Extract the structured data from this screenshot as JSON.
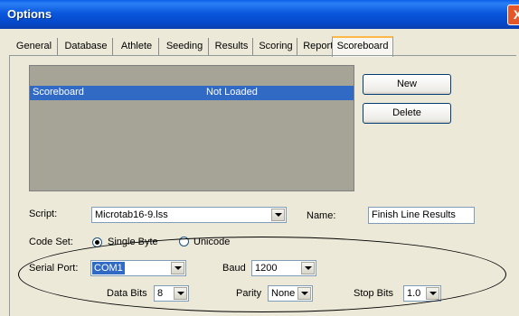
{
  "window": {
    "title": "Options",
    "close_glyph": "X"
  },
  "tabs": [
    {
      "label": "General"
    },
    {
      "label": "Database"
    },
    {
      "label": "Athlete"
    },
    {
      "label": "Seeding"
    },
    {
      "label": "Results"
    },
    {
      "label": "Scoring"
    },
    {
      "label": "Reports"
    },
    {
      "label": "Scoreboard",
      "active": true
    }
  ],
  "list": {
    "rows": [
      {
        "name": "Scoreboard",
        "status": "Not Loaded"
      }
    ]
  },
  "buttons": {
    "new_label": "New",
    "delete_label": "Delete"
  },
  "form": {
    "script_label": "Script:",
    "script_value": "Microtab16-9.lss",
    "name_label": "Name:",
    "name_value": "Finish Line Results",
    "code_set_label": "Code Set:",
    "single_byte_label": "Single Byte",
    "unicode_label": "Unicode",
    "code_set_selected": "Single Byte",
    "serial_port_label": "Serial Port:",
    "serial_port_value": "COM1",
    "baud_label": "Baud",
    "baud_value": "1200",
    "data_bits_label": "Data Bits",
    "data_bits_value": "8",
    "parity_label": "Parity",
    "parity_value": "None",
    "stop_bits_label": "Stop Bits",
    "stop_bits_value": "1.0"
  },
  "colors": {
    "titlebar": "#0a58dd",
    "selection": "#316ac5",
    "dialog_bg": "#ece9d8",
    "annotation": "#000000"
  }
}
